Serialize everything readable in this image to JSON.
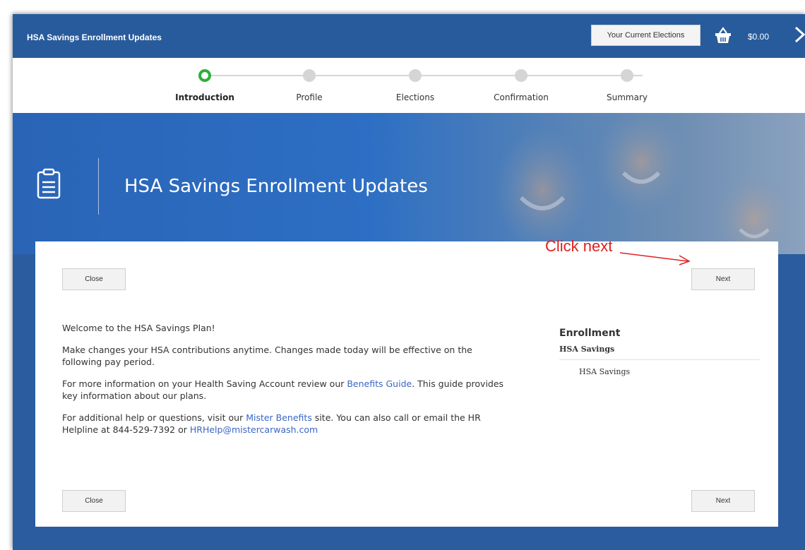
{
  "header": {
    "title": "HSA Savings Enrollment Updates",
    "elections_label": "Your Current Elections",
    "cart_total": "$0.00",
    "icons": [
      "shopping-basket-icon",
      "close-chevron-icon"
    ]
  },
  "stepper": {
    "steps": [
      {
        "label": "Introduction",
        "state": "active"
      },
      {
        "label": "Profile",
        "state": "pending"
      },
      {
        "label": "Elections",
        "state": "pending"
      },
      {
        "label": "Confirmation",
        "state": "pending"
      },
      {
        "label": "Summary",
        "state": "pending"
      }
    ]
  },
  "hero": {
    "title": "HSA Savings Enrollment Updates",
    "icon": "clipboard-icon"
  },
  "annotation": {
    "text": "Click next"
  },
  "actions": {
    "close_label": "Close",
    "next_label": "Next"
  },
  "content": {
    "welcome": "Welcome to the HSA Savings Plan!",
    "para1": "Make changes your HSA contributions anytime. Changes made today will be effective on the following pay period.",
    "para2_pre": "For more information on your Health Saving Account review our ",
    "para2_link": "Benefits Guide",
    "para2_post": ". This guide provides key information about our plans.",
    "para3_pre": "For additional help or questions, visit our ",
    "para3_link": "Mister Benefits",
    "para3_mid": " site.  You can also call or email the HR Helpline at 844-529-7392 or ",
    "para3_email": "HRHelp@mistercarwash.com"
  },
  "sidebar": {
    "heading": "Enrollment",
    "group": "HSA Savings",
    "item": "HSA Savings"
  },
  "colors": {
    "header_blue": "#285b9c",
    "hero_blue": "#2d6fc4",
    "active_step": "#2fae3a",
    "annotation_red": "#e02020",
    "link_blue": "#3a66c5"
  }
}
